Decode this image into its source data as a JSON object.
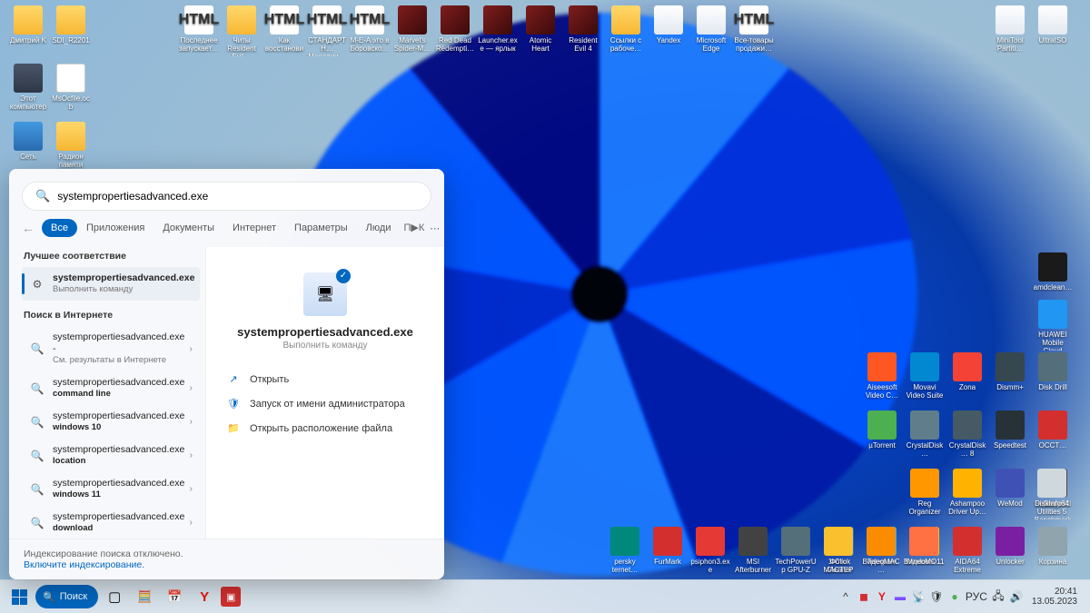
{
  "desktop_icons_rows": [
    [
      {
        "label": "Дмитрий K",
        "type": "folder"
      },
      {
        "label": "SDI_R2201",
        "type": "folder"
      },
      null,
      null,
      {
        "label": "Последнее запускает…",
        "type": "html"
      },
      {
        "label": "Читы Resident Evil…",
        "type": "folder"
      },
      {
        "label": "Как восстанови…",
        "type": "html"
      },
      {
        "label": "СТАНДАРТН… Мелодии…",
        "type": "html"
      },
      {
        "label": "M-E-A это в Боровско…",
        "type": "html"
      },
      {
        "label": "Marvel's Spider-M…",
        "type": "game"
      },
      {
        "label": "Red Dead Redempti…",
        "type": "game"
      },
      {
        "label": "Launcher.exe — ярлык",
        "type": "game"
      },
      {
        "label": "Atomic Heart",
        "type": "game"
      },
      {
        "label": "Resident Evil 4",
        "type": "game"
      },
      {
        "label": "Ссылки с рабоче…",
        "type": "folder"
      },
      {
        "label": "Yandex",
        "type": "app"
      },
      {
        "label": "Microsoft Edge",
        "type": "app"
      },
      {
        "label": "Все-товары продажи…",
        "type": "html"
      },
      null,
      null,
      null,
      null,
      null,
      {
        "label": "MiniTool Partiti…",
        "type": "app"
      },
      {
        "label": "UltraISO",
        "type": "app"
      }
    ],
    [
      {
        "label": "Этот компьютер",
        "type": "pc"
      },
      {
        "label": "MsOcfile.ocb",
        "type": "file"
      }
    ],
    [
      {
        "label": "Сеть",
        "type": "net"
      },
      {
        "label": "Радион памяти",
        "type": "folder"
      }
    ]
  ],
  "right_grid": [
    [
      {
        "label": "amdclean…",
        "c": "#1a1a1a"
      }
    ],
    [
      {
        "label": "HUAWEI Mobile Cloud",
        "c": "#2196f3"
      }
    ],
    [
      {
        "label": "Aiseesoft Video C…",
        "c": "#ff5722"
      },
      {
        "label": "Movavi Video Suite",
        "c": "#0288d1"
      },
      {
        "label": "Zona",
        "c": "#f44336"
      },
      {
        "label": "Dismm+",
        "c": "#37474f"
      },
      {
        "label": "Disk Drill",
        "c": "#546e7a"
      }
    ],
    [
      {
        "label": "µTorrent",
        "c": "#4caf50"
      },
      {
        "label": "CrystalDisk…",
        "c": "#607d8b"
      },
      {
        "label": "CrystalDisk… 8",
        "c": "#455a64"
      },
      {
        "label": "Speedtest",
        "c": "#263238"
      },
      {
        "label": "OCCT…",
        "c": "#d32f2f"
      }
    ],
    [
      {
        "label": "DiskInfo64",
        "c": "#cfd8dc",
        "r": -1
      },
      {
        "label": "Glary Utilities 5",
        "c": "#0d47a1",
        "r": -1
      },
      {
        "label": "Reg Organizer",
        "c": "#ff9800"
      },
      {
        "label": "Ashampoo Driver Up…",
        "c": "#ffb300"
      },
      {
        "label": "WeMod",
        "c": "#3f51b5"
      },
      {
        "label": "Superpositi… Benchmark",
        "c": "#5d4037"
      }
    ],
    [
      {
        "label": "persky ternet…",
        "c": "#00897b",
        "r": -11
      },
      {
        "label": "FurMark",
        "c": "#d32f2f",
        "r": -10
      },
      {
        "label": "psiphon3.exe",
        "c": "#e53935",
        "r": -9
      },
      {
        "label": "MSI Afterburner",
        "c": "#424242",
        "r": -8
      },
      {
        "label": "TechPowerUp GPU-Z",
        "c": "#546e7a",
        "r": -7
      },
      {
        "label": "Фото МАСТЕР",
        "c": "#fbc02d",
        "r": -6
      },
      {
        "label": "ВидеоМАС…",
        "c": "#fb8c00",
        "r": -5
      },
      {
        "label": "ВидеоМО…",
        "c": "#ff7043",
        "r": -4
      },
      null,
      null,
      {
        "label": "1-Click Cleaner",
        "c": "#1976d2"
      },
      {
        "label": "Telegram",
        "c": "#29b6f6"
      },
      {
        "label": "Windows 11",
        "c": "#ffc107"
      },
      {
        "label": "AIDA64 Extreme",
        "c": "#d32f2f"
      },
      {
        "label": "Unlocker",
        "c": "#7b1fa2"
      },
      {
        "label": "Корзина",
        "c": "#90a4ae"
      }
    ]
  ],
  "search": {
    "query": "systempropertiesadvanced.exe",
    "tabs": [
      "Все",
      "Приложения",
      "Документы",
      "Интернет",
      "Параметры",
      "Люди"
    ],
    "tab_letters": [
      "П",
      "▶",
      "К"
    ],
    "best_match_title": "Лучшее соответствие",
    "best_result": {
      "title": "systempropertiesadvanced.exe",
      "sub": "Выполнить команду"
    },
    "web_title": "Поиск в Интернете",
    "web_results": [
      {
        "title": "systempropertiesadvanced.exe -",
        "sub": "См. результаты в Интернете"
      },
      {
        "title": "systempropertiesadvanced.exe",
        "sub": "command line",
        "bold": true
      },
      {
        "title": "systempropertiesadvanced.exe",
        "sub": "windows 10",
        "bold": true
      },
      {
        "title": "systempropertiesadvanced.exe",
        "sub": "location",
        "bold": true
      },
      {
        "title": "systempropertiesadvanced.exe",
        "sub": "windows 11",
        "bold": true
      },
      {
        "title": "systempropertiesadvanced.exe",
        "sub": "download",
        "bold": true
      }
    ],
    "preview": {
      "title": "systempropertiesadvanced.exe",
      "sub": "Выполнить команду"
    },
    "actions": [
      {
        "icon": "↗",
        "label": "Открыть"
      },
      {
        "icon": "🛡",
        "label": "Запуск от имени администратора"
      },
      {
        "icon": "📁",
        "label": "Открыть расположение файла"
      }
    ],
    "footer_text": "Индексирование поиска отключено.",
    "footer_link": "Включите индексирование."
  },
  "taskbar": {
    "search_label": "Поиск",
    "pinned_center": [
      "📊",
      "🎮",
      "📄",
      "▦",
      "🔵",
      "🟥",
      "🌐",
      "⚙"
    ],
    "tray": [
      "^",
      "🟥",
      "Y",
      "▬",
      "📶",
      "🛡",
      "🟢",
      "РУС",
      "🔈",
      "⏻"
    ],
    "lang": "РУС",
    "time": "20:41",
    "date": "13.05.2023"
  }
}
